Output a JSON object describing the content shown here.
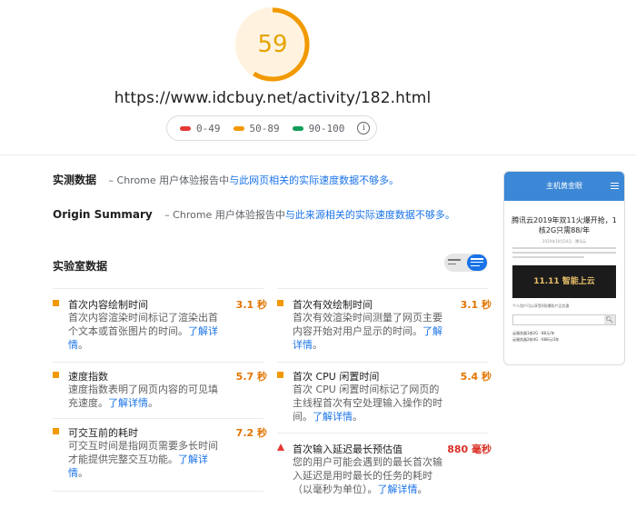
{
  "header": {
    "score": "59",
    "score_fraction": 0.59,
    "score_color": "#f29900",
    "url": "https://www.idcbuy.net/activity/182.html",
    "legend": [
      {
        "label": "0-49",
        "color": "#e53935"
      },
      {
        "label": "50-89",
        "color": "#f29900"
      },
      {
        "label": "90-100",
        "color": "#0f9d58"
      }
    ],
    "info_icon": "i"
  },
  "field_data": {
    "title": "实测数据",
    "prefix": " – Chrome 用户体验报告中",
    "link": "与此网页相关的实际速度数据不够多。"
  },
  "origin_summary": {
    "title": "Origin Summary",
    "prefix": " – Chrome 用户体验报告中",
    "link": "与此来源相关的实际速度数据不够多。"
  },
  "lab": {
    "title": "实验室数据",
    "learn_more": "了解详情",
    "metrics": [
      {
        "name": "首次内容绘制时间",
        "value": "3.1 秒",
        "desc": "首次内容渲染时间标记了渲染出首个文本或首张图片的时间。",
        "status": "average"
      },
      {
        "name": "首次有效绘制时间",
        "value": "3.1 秒",
        "desc": "首次有效渲染时间测量了网页主要内容开始对用户显示的时间。",
        "status": "average"
      },
      {
        "name": "速度指数",
        "value": "5.7 秒",
        "desc": "速度指数表明了网页内容的可见填充速度。",
        "status": "average"
      },
      {
        "name": "首次 CPU 闲置时间",
        "value": "5.4 秒",
        "desc": "首次 CPU 闲置时间标记了网页的主线程首次有空处理输入操作的时间。",
        "status": "average"
      },
      {
        "name": "可交互前的耗时",
        "value": "7.2 秒",
        "desc": "可交互时间是指网页需要多长时间才能提供完整交互功能。",
        "status": "average"
      },
      {
        "name": "首次输入延迟最长预估值",
        "value": "880 毫秒",
        "desc": "您的用户可能会遇到的最长首次输入延迟是用时最长的任务的耗时（以毫秒为单位）。",
        "status": "fail"
      }
    ]
  },
  "thumbnail": {
    "site_name": "主机黄金眼",
    "headline": "腾讯云2019年双11火爆开抢，1核2G只需88/年",
    "meta": "2019年10月24日 · 腾讯云",
    "banner": "11.11 智能上云",
    "note": "个人用户可以享受4款爆款产品优惠",
    "list": [
      "云服务器1核2G · 88元/年",
      "云服务器2核4G · 688元/3年"
    ]
  }
}
